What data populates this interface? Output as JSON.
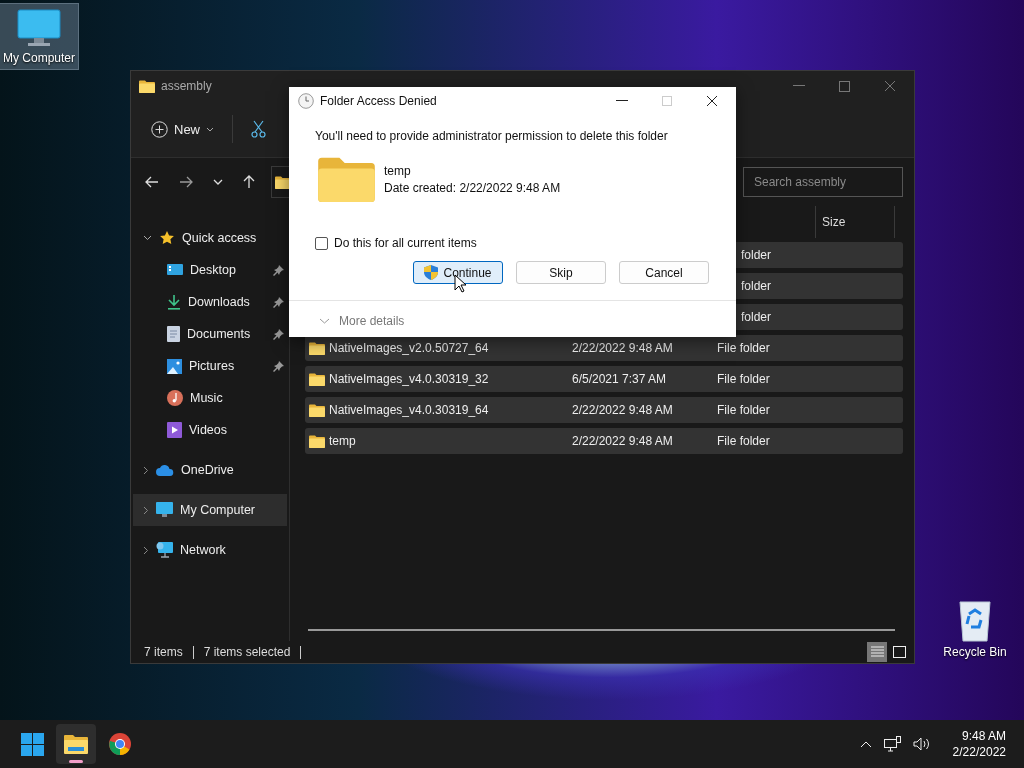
{
  "desktop_icons": [
    {
      "label": "My Computer",
      "kind": "computer",
      "selected": true
    },
    {
      "label": "Recycle Bin",
      "kind": "recycle",
      "selected": false
    }
  ],
  "explorer": {
    "title": "assembly",
    "new_label": "New",
    "search": {
      "placeholder": "Search assembly"
    },
    "columns": [
      "Size"
    ],
    "sidebar": [
      {
        "label": "Quick access",
        "kind": "star",
        "expanded": true,
        "selected": false,
        "children": [
          {
            "label": "Desktop",
            "kind": "desktop",
            "pinned": true
          },
          {
            "label": "Downloads",
            "kind": "downloads",
            "pinned": true
          },
          {
            "label": "Documents",
            "kind": "documents",
            "pinned": true
          },
          {
            "label": "Pictures",
            "kind": "pictures",
            "pinned": true
          },
          {
            "label": "Music",
            "kind": "music",
            "pinned": false
          },
          {
            "label": "Videos",
            "kind": "videos",
            "pinned": false
          }
        ]
      },
      {
        "label": "OneDrive",
        "kind": "cloud",
        "expanded": false,
        "selected": false
      },
      {
        "label": "My Computer",
        "kind": "computer",
        "expanded": false,
        "selected": true
      },
      {
        "label": "Network",
        "kind": "network",
        "expanded": false,
        "selected": false
      }
    ],
    "rows": [
      {
        "type": "folder",
        "obscured": true,
        "selected": true
      },
      {
        "type": "folder",
        "obscured": true,
        "selected": true
      },
      {
        "type": "folder",
        "obscured": true,
        "selected": true
      },
      {
        "name": "NativeImages_v2.0.50727_64",
        "date": "2/22/2022 9:48 AM",
        "type": "File folder",
        "obscured": false,
        "selected": true
      },
      {
        "name": "NativeImages_v4.0.30319_32",
        "date": "6/5/2021 7:37 AM",
        "type": "File folder",
        "obscured": false,
        "selected": true
      },
      {
        "name": "NativeImages_v4.0.30319_64",
        "date": "2/22/2022 9:48 AM",
        "type": "File folder",
        "obscured": false,
        "selected": true
      },
      {
        "name": "temp",
        "date": "2/22/2022 9:48 AM",
        "type": "File folder",
        "obscured": false,
        "selected": true
      }
    ],
    "status": {
      "count": "7 items",
      "selection": "7 items selected"
    },
    "views": [
      {
        "kind": "details",
        "selected": true
      },
      {
        "kind": "tiles",
        "selected": false
      }
    ]
  },
  "dialog": {
    "title": "Folder Access Denied",
    "message": "You'll need to provide administrator permission to delete this folder",
    "item": {
      "name": "temp",
      "date": "Date created: 2/22/2022 9:48 AM"
    },
    "checkbox": {
      "label": "Do this for all current items",
      "checked": false
    },
    "buttons": [
      {
        "label": "Continue",
        "kind": "shield",
        "focused": true
      },
      {
        "label": "Skip",
        "kind": "plain",
        "focused": false
      },
      {
        "label": "Cancel",
        "kind": "plain",
        "focused": false
      }
    ],
    "details": {
      "label": "More details",
      "expanded": false
    }
  },
  "taskbar": {
    "apps": [
      {
        "kind": "start",
        "active": false
      },
      {
        "kind": "explorer",
        "active": true
      },
      {
        "kind": "browser",
        "active": false
      }
    ],
    "time": "9:48 AM",
    "date": "2/22/2022"
  }
}
